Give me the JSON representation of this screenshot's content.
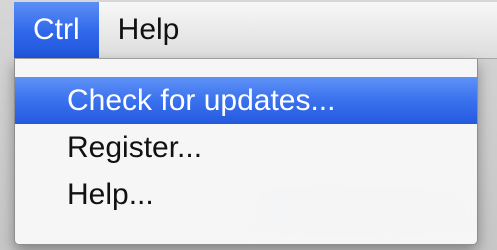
{
  "menubar": {
    "items": [
      {
        "label": "Ctrl",
        "active": true
      },
      {
        "label": "Help",
        "active": false
      }
    ]
  },
  "dropdown": {
    "items": [
      {
        "label": "Check for updates...",
        "highlighted": true
      },
      {
        "label": "Register...",
        "highlighted": false
      },
      {
        "label": "Help...",
        "highlighted": false
      }
    ]
  },
  "colors": {
    "highlight": "#2f67ea",
    "menu_background": "#f7f7f7"
  }
}
